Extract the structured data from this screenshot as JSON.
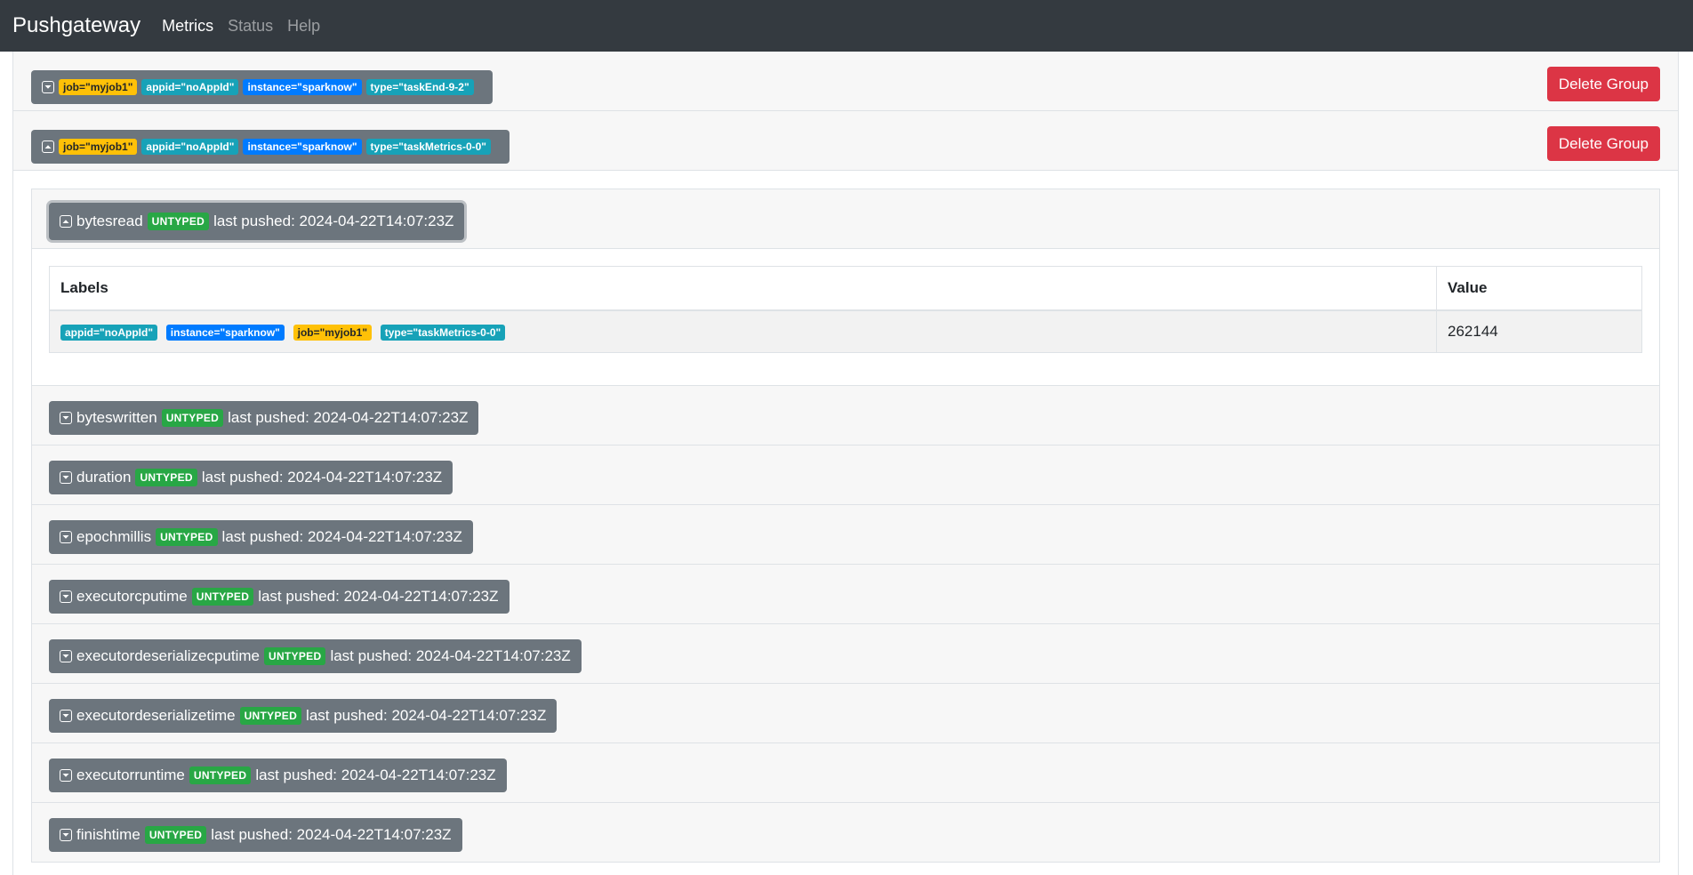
{
  "navbar": {
    "brand": "Pushgateway",
    "links": [
      {
        "label": "Metrics",
        "active": true
      },
      {
        "label": "Status",
        "active": false
      },
      {
        "label": "Help",
        "active": false
      }
    ]
  },
  "groups": [
    {
      "labels": [
        {
          "text": "job=\"myjob1\"",
          "color": "#ffc107"
        },
        {
          "text": "appid=\"noAppId\"",
          "color": "#17a2b8"
        },
        {
          "text": "instance=\"sparknow\"",
          "color": "#007bff"
        },
        {
          "text": "type=\"taskEnd-9-2\"",
          "color": "#17a2b8"
        }
      ],
      "delete_label": "Delete Group"
    },
    {
      "labels": [
        {
          "text": "job=\"myjob1\"",
          "color": "#ffc107"
        },
        {
          "text": "appid=\"noAppId\"",
          "color": "#17a2b8"
        },
        {
          "text": "instance=\"sparknow\"",
          "color": "#007bff"
        },
        {
          "text": "type=\"taskMetrics-0-0\"",
          "color": "#17a2b8"
        }
      ],
      "delete_label": "Delete Group"
    }
  ],
  "expanded_metric": {
    "name": "bytesread",
    "type": "UNTYPED",
    "last_pushed": "last pushed: 2024-04-22T14:07:23Z",
    "table": {
      "headers": [
        "Labels",
        "Value"
      ],
      "row": {
        "labels": [
          {
            "text": "appid=\"noAppId\"",
            "color": "#17a2b8"
          },
          {
            "text": "instance=\"sparknow\"",
            "color": "#007bff"
          },
          {
            "text": "job=\"myjob1\"",
            "color": "#ffc107"
          },
          {
            "text": "type=\"taskMetrics-0-0\"",
            "color": "#17a2b8"
          }
        ],
        "value": "262144"
      }
    }
  },
  "metrics": [
    {
      "name": "byteswritten",
      "type": "UNTYPED",
      "last_pushed": "last pushed: 2024-04-22T14:07:23Z"
    },
    {
      "name": "duration",
      "type": "UNTYPED",
      "last_pushed": "last pushed: 2024-04-22T14:07:23Z"
    },
    {
      "name": "epochmillis",
      "type": "UNTYPED",
      "last_pushed": "last pushed: 2024-04-22T14:07:23Z"
    },
    {
      "name": "executorcputime",
      "type": "UNTYPED",
      "last_pushed": "last pushed: 2024-04-22T14:07:23Z"
    },
    {
      "name": "executordeserializecputime",
      "type": "UNTYPED",
      "last_pushed": "last pushed: 2024-04-22T14:07:23Z"
    },
    {
      "name": "executordeserializetime",
      "type": "UNTYPED",
      "last_pushed": "last pushed: 2024-04-22T14:07:23Z"
    },
    {
      "name": "executorruntime",
      "type": "UNTYPED",
      "last_pushed": "last pushed: 2024-04-22T14:07:23Z"
    },
    {
      "name": "finishtime",
      "type": "UNTYPED",
      "last_pushed": "last pushed: 2024-04-22T14:07:23Z"
    }
  ],
  "icons": {
    "expand": "chevron-down-square-icon",
    "collapse": "chevron-up-square-icon"
  }
}
